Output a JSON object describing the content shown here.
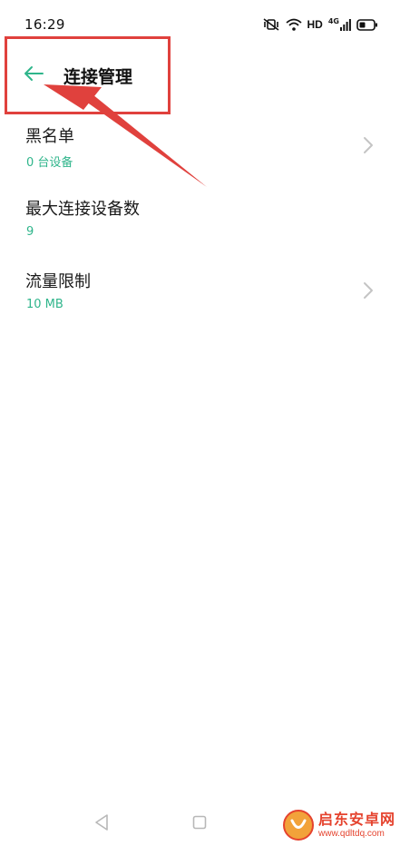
{
  "status_bar": {
    "time": "16:29",
    "network_label": "HD",
    "cell_label": "4G"
  },
  "header": {
    "title": "连接管理",
    "back_icon": "arrow-left-icon"
  },
  "settings": [
    {
      "title": "黑名单",
      "value": "0 台设备",
      "has_chevron": true
    },
    {
      "title": "最大连接设备数",
      "value": "9",
      "has_chevron": false
    },
    {
      "title": "流量限制",
      "value": "10 MB",
      "has_chevron": true
    }
  ],
  "colors": {
    "accent": "#2fb58b",
    "annotation": "#e0413d",
    "text": "#1a1a1a",
    "chevron": "#c4c4c4"
  },
  "watermark": {
    "name": "启东安卓网",
    "url": "www.qdltdq.com"
  }
}
